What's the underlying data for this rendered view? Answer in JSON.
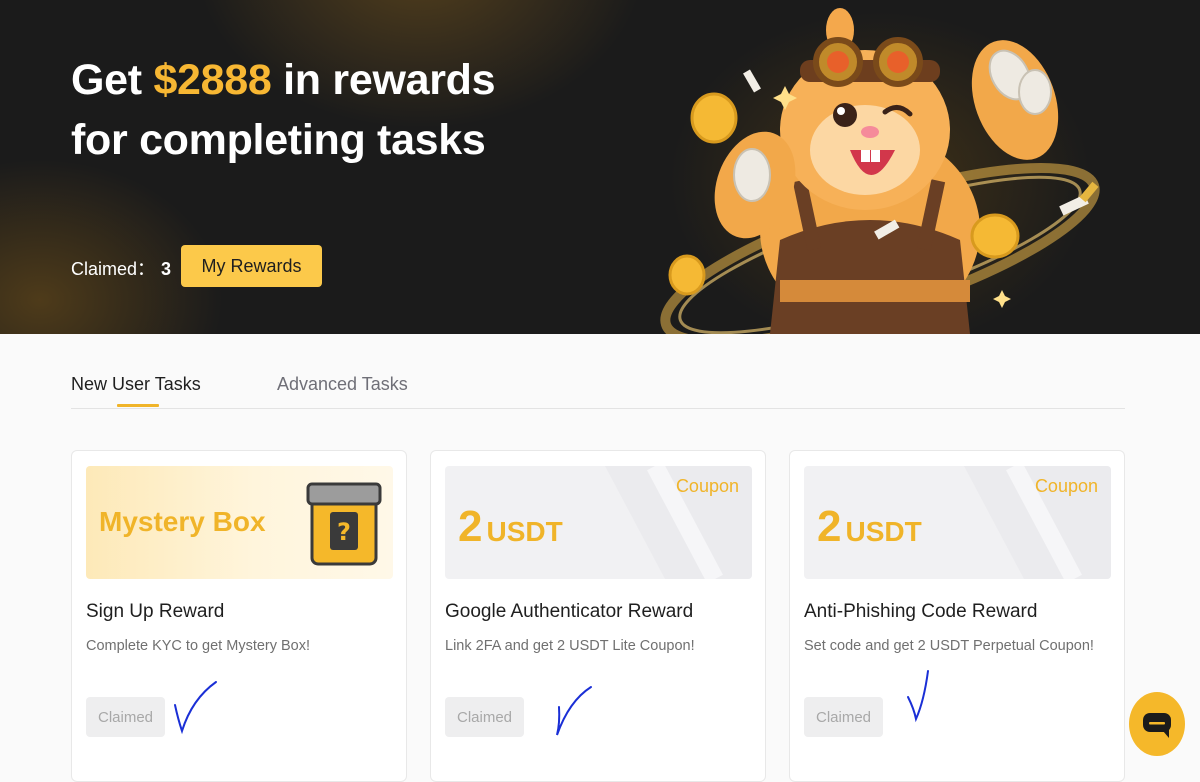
{
  "hero": {
    "title_prefix": "Get ",
    "amount": "$2888",
    "title_suffix": " in rewards",
    "title_line2": "for completing tasks",
    "claimed_label": "Claimed：",
    "claimed_count": "3",
    "my_rewards_button": "My Rewards"
  },
  "tabs": [
    {
      "label": "New User Tasks",
      "active": true
    },
    {
      "label": "Advanced Tasks",
      "active": false
    }
  ],
  "cards": [
    {
      "banner_text": "Mystery Box",
      "title": "Sign Up Reward",
      "description": "Complete KYC to get Mystery Box!",
      "status": "Claimed",
      "icon": "mystery-box-icon"
    },
    {
      "banner_amount": "2",
      "banner_unit": "USDT",
      "banner_label": "Coupon",
      "title": "Google Authenticator Reward",
      "description": "Link 2FA and get 2 USDT Lite Coupon!",
      "status": "Claimed"
    },
    {
      "banner_amount": "2",
      "banner_unit": "USDT",
      "banner_label": "Coupon",
      "title": "Anti-Phishing Code Reward",
      "description": "Set code and get 2 USDT Perpetual Coupon!",
      "status": "Claimed"
    }
  ],
  "colors": {
    "accent": "#f0b429",
    "hero_bg": "#1b1b1b",
    "button_yellow": "#fcc94a",
    "check_ink": "#1a2fd6"
  },
  "chat": {
    "icon": "chat-bubble-icon"
  }
}
